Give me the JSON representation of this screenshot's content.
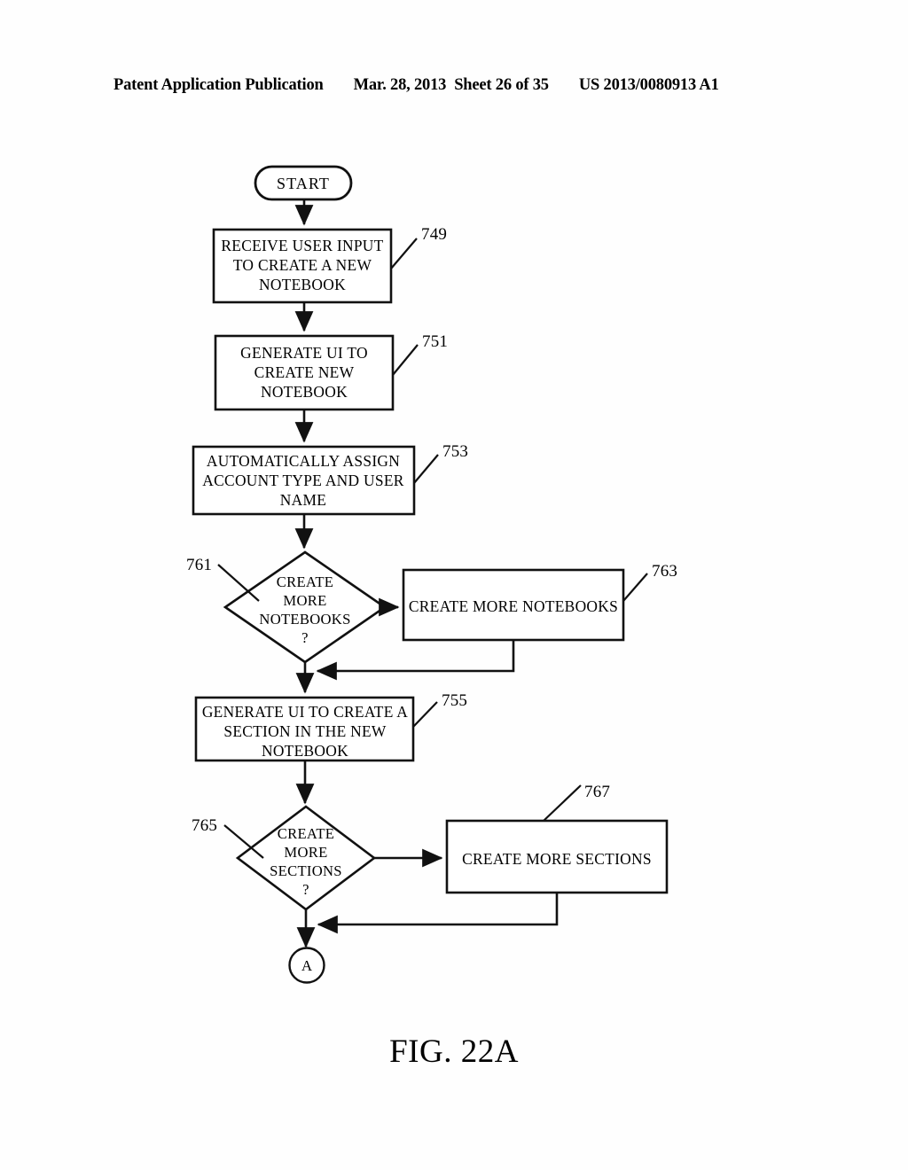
{
  "header": {
    "publication": "Patent Application Publication",
    "date": "Mar. 28, 2013",
    "sheet": "Sheet 26 of 35",
    "document_number": "US 2013/0080913 A1"
  },
  "figure": {
    "caption": "FIG. 22A",
    "type": "flowchart"
  },
  "nodes": {
    "start": {
      "label": "START",
      "shape": "rounded-terminal"
    },
    "n749": {
      "ref": "749",
      "shape": "process",
      "line1": "RECEIVE USER INPUT",
      "line2": "TO CREATE A NEW",
      "line3": "NOTEBOOK"
    },
    "n751": {
      "ref": "751",
      "shape": "process",
      "line1": "GENERATE UI TO",
      "line2": "CREATE NEW",
      "line3": "NOTEBOOK"
    },
    "n753": {
      "ref": "753",
      "shape": "process",
      "line1": "AUTOMATICALLY ASSIGN",
      "line2": "ACCOUNT TYPE AND USER",
      "line3": "NAME"
    },
    "n761": {
      "ref": "761",
      "shape": "decision",
      "line1": "CREATE",
      "line2": "MORE",
      "line3": "NOTEBOOKS",
      "line4": "?"
    },
    "n763": {
      "ref": "763",
      "shape": "process",
      "line1": "CREATE MORE NOTEBOOKS"
    },
    "n755": {
      "ref": "755",
      "shape": "process",
      "line1": "GENERATE UI TO CREATE A",
      "line2": "SECTION IN THE NEW",
      "line3": "NOTEBOOK"
    },
    "n765": {
      "ref": "765",
      "shape": "decision",
      "line1": "CREATE",
      "line2": "MORE",
      "line3": "SECTIONS",
      "line4": "?"
    },
    "n767": {
      "ref": "767",
      "shape": "process",
      "line1": "CREATE MORE SECTIONS"
    },
    "connector_a": {
      "label": "A",
      "shape": "circle-connector"
    }
  }
}
